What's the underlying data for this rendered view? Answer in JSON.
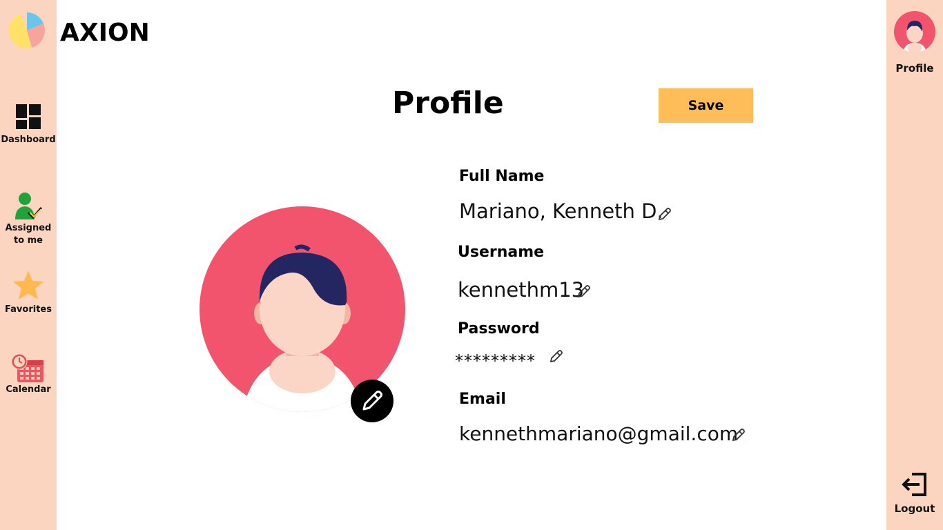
{
  "app": {
    "name": "AXION"
  },
  "sidebar": {
    "items": [
      {
        "label": "Dashboard"
      },
      {
        "label": "Assigned to me"
      },
      {
        "label": "Favorites"
      },
      {
        "label": "Calendar"
      }
    ]
  },
  "right_sidebar": {
    "profile_label": "Profile",
    "logout_label": "Logout"
  },
  "main": {
    "title": "Profile",
    "save_label": "Save",
    "fields": [
      {
        "label": "Full Name",
        "value": "Mariano, Kenneth D."
      },
      {
        "label": "Username",
        "value": "kennethm13"
      },
      {
        "label": "Password",
        "value": "*********"
      },
      {
        "label": "Email",
        "value": "kennethmariano@gmail.com"
      }
    ]
  },
  "icons": {
    "logo": "pie-logo-icon",
    "dashboard": "dashboard-grid-icon",
    "assigned": "user-check-icon",
    "favorites": "star-icon",
    "calendar": "calendar-clock-icon",
    "profile": "user-avatar-icon",
    "logout": "logout-icon",
    "edit": "pencil-icon"
  },
  "colors": {
    "sidebar_bg": "#fcd5c0",
    "save_button": "#ffbd59",
    "avatar_bg": "#f1546c",
    "hair": "#232660",
    "skin": "#fbd5c5",
    "star": "#ffb84d",
    "assigned_green": "#1fa33a",
    "calendar_red": "#f0555d"
  }
}
